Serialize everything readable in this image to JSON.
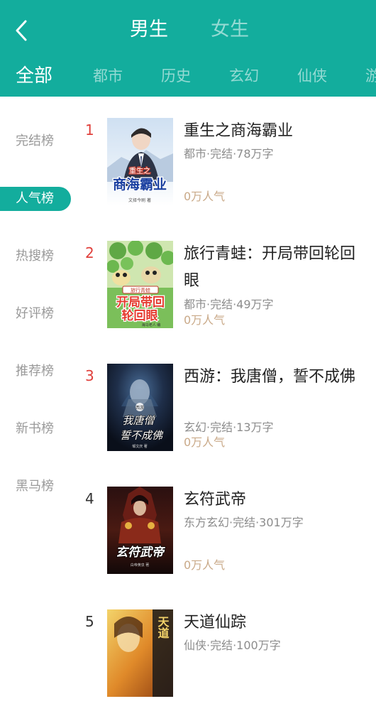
{
  "header": {
    "gender_tabs": [
      "男生",
      "女生"
    ],
    "category_tabs": [
      "全部",
      "都市",
      "历史",
      "玄幻",
      "仙侠",
      "游"
    ]
  },
  "sidebar": {
    "items": [
      "完结榜",
      "人气榜",
      "热搜榜",
      "好评榜",
      "推荐榜",
      "新书榜",
      "黑马榜"
    ],
    "active": "人气榜"
  },
  "books": [
    {
      "rank": "1",
      "title": "重生之商海霸业",
      "meta": "都市·完结·78万字",
      "popularity": "0万人气"
    },
    {
      "rank": "2",
      "title": "旅行青蛙：开局带回轮回眼",
      "meta": "都市·完结·49万字",
      "popularity": "0万人气"
    },
    {
      "rank": "3",
      "title": "西游：我唐僧，誓不成佛",
      "meta": "玄幻·完结·13万字",
      "popularity": "0万人气"
    },
    {
      "rank": "4",
      "title": "玄符武帝",
      "meta": "东方玄幻·完结·301万字",
      "popularity": "0万人气"
    },
    {
      "rank": "5",
      "title": "天道仙踪",
      "meta": "仙侠·完结·100万字",
      "popularity": ""
    }
  ],
  "covers": [
    {
      "text_line1": "重生之",
      "text_line2": "商海霸业",
      "author": "文择今刷 著"
    },
    {
      "text_line1": "旅行青蛙",
      "text_line2": "开局带回",
      "text_line3": "轮回眼",
      "author": "海马老人 编"
    },
    {
      "text_line1": "西游",
      "text_line2": "我唐僧",
      "text_line3": "誓不成佛",
      "author": "邹文庆 著"
    },
    {
      "text_line1": "玄符武帝",
      "author": "白帝黄泉 著"
    },
    {
      "text_line1": "天道"
    }
  ],
  "colors": {
    "accent": "#13ad9d",
    "rank_top": "#e0403c",
    "popularity": "#c9a988"
  },
  "icons": {
    "back": "chevron-left-icon"
  }
}
